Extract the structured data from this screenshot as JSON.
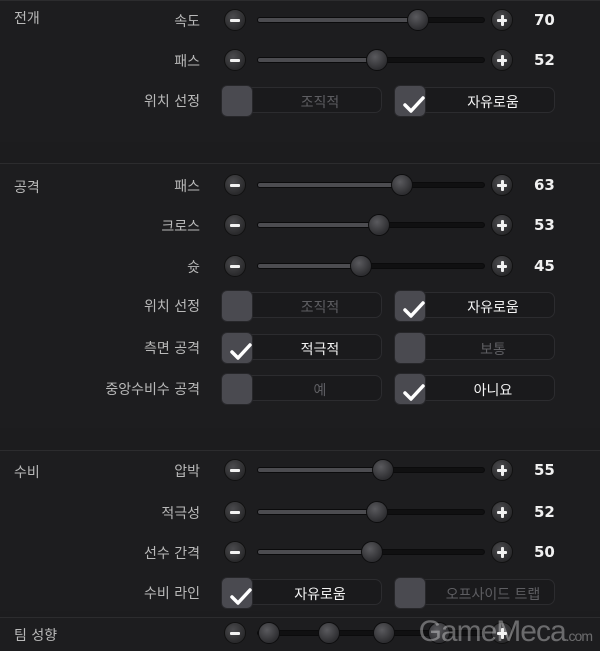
{
  "sections": [
    {
      "title": "전개",
      "rows": [
        {
          "type": "slider",
          "label": "속도",
          "value": 70
        },
        {
          "type": "slider",
          "label": "패스",
          "value": 52
        },
        {
          "type": "toggle",
          "label": "위치 선정",
          "options": [
            {
              "label": "조직적",
              "checked": false
            },
            {
              "label": "자유로움",
              "checked": true
            }
          ]
        }
      ]
    },
    {
      "title": "공격",
      "rows": [
        {
          "type": "slider",
          "label": "패스",
          "value": 63
        },
        {
          "type": "slider",
          "label": "크로스",
          "value": 53
        },
        {
          "type": "slider",
          "label": "슛",
          "value": 45
        },
        {
          "type": "toggle",
          "label": "위치 선정",
          "options": [
            {
              "label": "조직적",
              "checked": false
            },
            {
              "label": "자유로움",
              "checked": true
            }
          ]
        },
        {
          "type": "toggle",
          "label": "측면 공격",
          "options": [
            {
              "label": "적극적",
              "checked": true
            },
            {
              "label": "보통",
              "checked": false
            }
          ]
        },
        {
          "type": "toggle",
          "label": "중앙수비수 공격",
          "options": [
            {
              "label": "예",
              "checked": false
            },
            {
              "label": "아니요",
              "checked": true
            }
          ]
        }
      ]
    },
    {
      "title": "수비",
      "rows": [
        {
          "type": "slider",
          "label": "압박",
          "value": 55
        },
        {
          "type": "slider",
          "label": "적극성",
          "value": 52
        },
        {
          "type": "slider",
          "label": "선수 간격",
          "value": 50
        },
        {
          "type": "toggle",
          "label": "수비 라인",
          "options": [
            {
              "label": "자유로움",
              "checked": true
            },
            {
              "label": "오프사이드 트랩",
              "checked": false
            }
          ]
        }
      ]
    },
    {
      "title": "팀 성향",
      "rows": []
    }
  ],
  "watermark": {
    "text": "GameMeca",
    "suffix": ".com"
  }
}
